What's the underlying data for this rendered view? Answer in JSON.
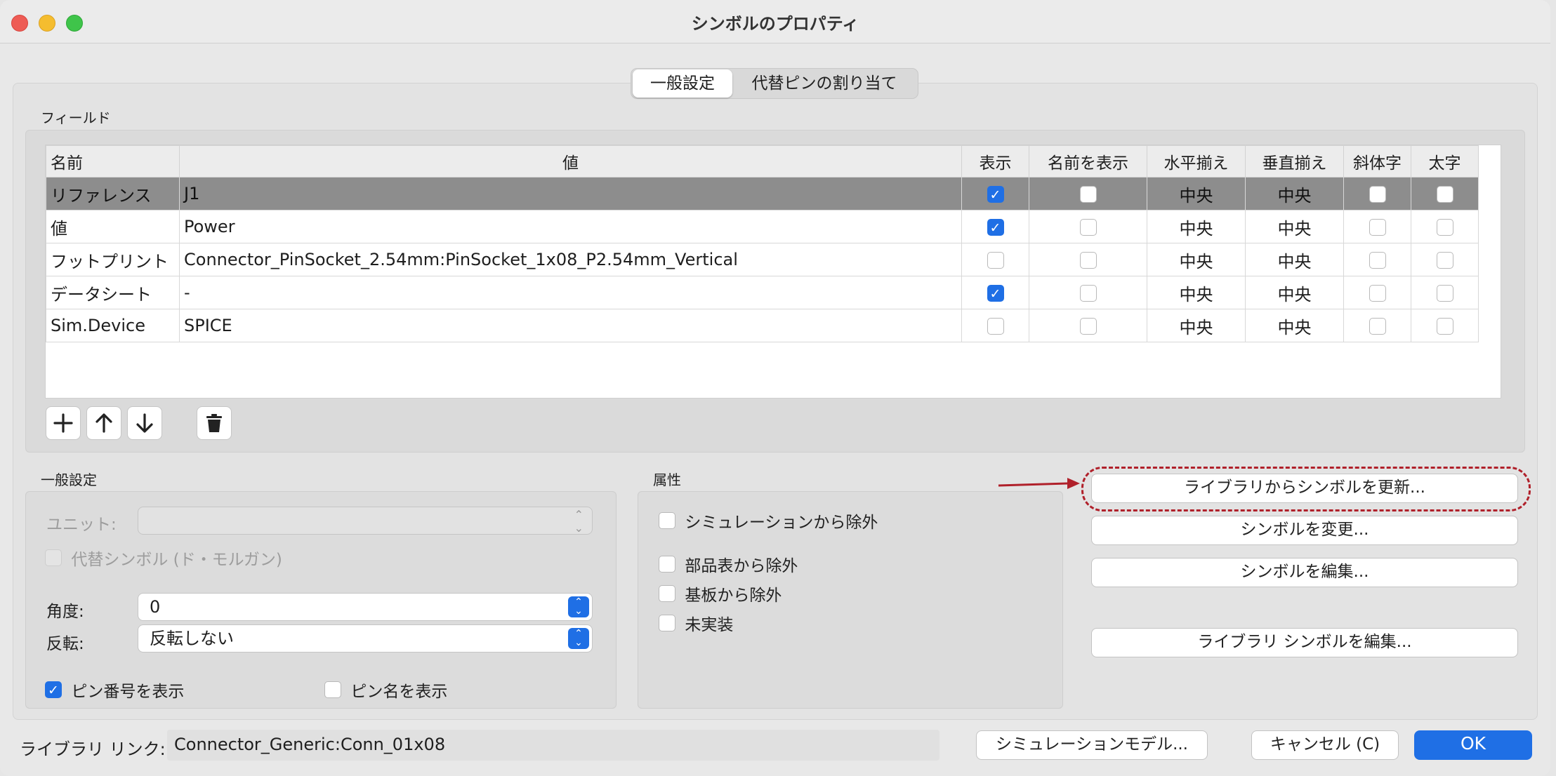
{
  "window": {
    "title": "シンボルのプロパティ"
  },
  "tabs": [
    {
      "label": "一般設定",
      "active": true
    },
    {
      "label": "代替ピンの割り当て",
      "active": false
    }
  ],
  "fields": {
    "group_label": "フィールド",
    "columns": [
      "名前",
      "値",
      "表示",
      "名前を表示",
      "水平揃え",
      "垂直揃え",
      "斜体字",
      "太字"
    ],
    "rows": [
      {
        "name": "リファレンス",
        "value": "J1",
        "show": true,
        "show_name": false,
        "h_align": "中央",
        "v_align": "中央",
        "italic": false,
        "bold": false,
        "selected": true
      },
      {
        "name": "値",
        "value": "Power",
        "show": true,
        "show_name": false,
        "h_align": "中央",
        "v_align": "中央",
        "italic": false,
        "bold": false,
        "selected": false
      },
      {
        "name": "フットプリント",
        "value": "Connector_PinSocket_2.54mm:PinSocket_1x08_P2.54mm_Vertical",
        "show": false,
        "show_name": false,
        "h_align": "中央",
        "v_align": "中央",
        "italic": false,
        "bold": false,
        "selected": false
      },
      {
        "name": "データシート",
        "value": "-",
        "show": true,
        "show_name": false,
        "h_align": "中央",
        "v_align": "中央",
        "italic": false,
        "bold": false,
        "selected": false
      },
      {
        "name": "Sim.Device",
        "value": "SPICE",
        "show": false,
        "show_name": false,
        "h_align": "中央",
        "v_align": "中央",
        "italic": false,
        "bold": false,
        "selected": false
      }
    ],
    "toolbar_icons": [
      "add-icon",
      "arrow-up-icon",
      "arrow-down-icon",
      "trash-icon"
    ]
  },
  "general": {
    "group_label": "一般設定",
    "unit_label": "ユニット:",
    "unit_value": "",
    "alt_symbol_label": "代替シンボル (ド・モルガン)",
    "alt_symbol_checked": false,
    "angle_label": "角度:",
    "angle_value": "0",
    "mirror_label": "反転:",
    "mirror_value": "反転しない",
    "show_pin_numbers_label": "ピン番号を表示",
    "show_pin_numbers": true,
    "show_pin_names_label": "ピン名を表示",
    "show_pin_names": false
  },
  "attributes": {
    "group_label": "属性",
    "items": [
      {
        "label": "シミュレーションから除外",
        "checked": false
      },
      {
        "label": "部品表から除外",
        "checked": false
      },
      {
        "label": "基板から除外",
        "checked": false
      },
      {
        "label": "未実装",
        "checked": false
      }
    ]
  },
  "actions": {
    "update_from_library": "ライブラリからシンボルを更新...",
    "change_symbol": "シンボルを変更...",
    "edit_symbol": "シンボルを編集...",
    "edit_library_symbol": "ライブラリ シンボルを編集..."
  },
  "footer": {
    "library_link_label": "ライブラリ リンク:",
    "library_link_value": "Connector_Generic:Conn_01x08",
    "simulation_model": "シミュレーションモデル...",
    "cancel": "キャンセル (C)",
    "ok": "OK"
  },
  "colors": {
    "accent": "#1f6fe5",
    "highlight_annotation": "#b0202a",
    "selected_row": "#8d8d8d"
  }
}
